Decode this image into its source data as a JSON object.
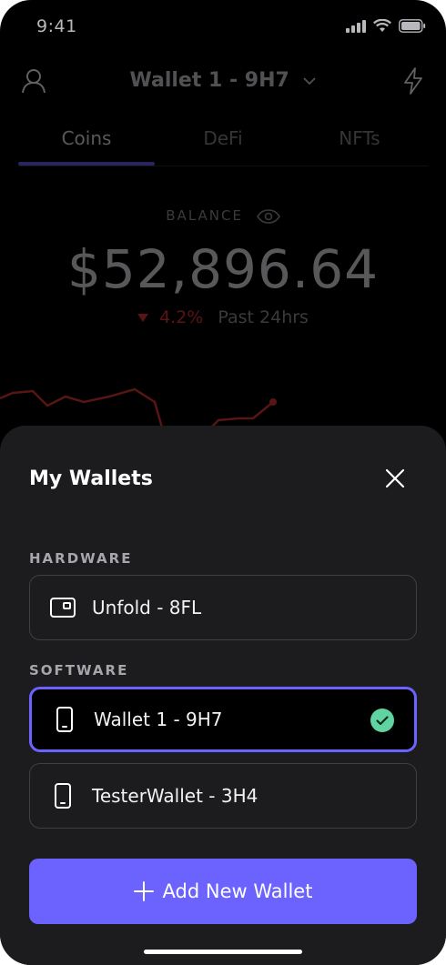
{
  "status_bar": {
    "time": "9:41"
  },
  "header": {
    "wallet_name": "Wallet 1 - 9H7"
  },
  "tabs": [
    {
      "label": "Coins",
      "active": true
    },
    {
      "label": "DeFi",
      "active": false
    },
    {
      "label": "NFTs",
      "active": false
    }
  ],
  "balance": {
    "label": "BALANCE",
    "value": "$52,896.64",
    "change": "4.2%",
    "period": "Past 24hrs"
  },
  "sheet": {
    "title": "My Wallets",
    "hardware_label": "HARDWARE",
    "software_label": "SOFTWARE",
    "hardware_wallets": [
      {
        "name": "Unfold - 8FL",
        "icon": "hardware-wallet-icon"
      }
    ],
    "software_wallets": [
      {
        "name": "Wallet 1 - 9H7",
        "icon": "phone-icon",
        "selected": true
      },
      {
        "name": "TesterWallet - 3H4",
        "icon": "phone-icon",
        "selected": false
      }
    ],
    "add_button_label": "Add New Wallet"
  },
  "colors": {
    "accent": "#6c63ff",
    "sheet_bg": "#1c1c1f",
    "check_green": "#5fd4a0",
    "negative": "#e53935"
  }
}
